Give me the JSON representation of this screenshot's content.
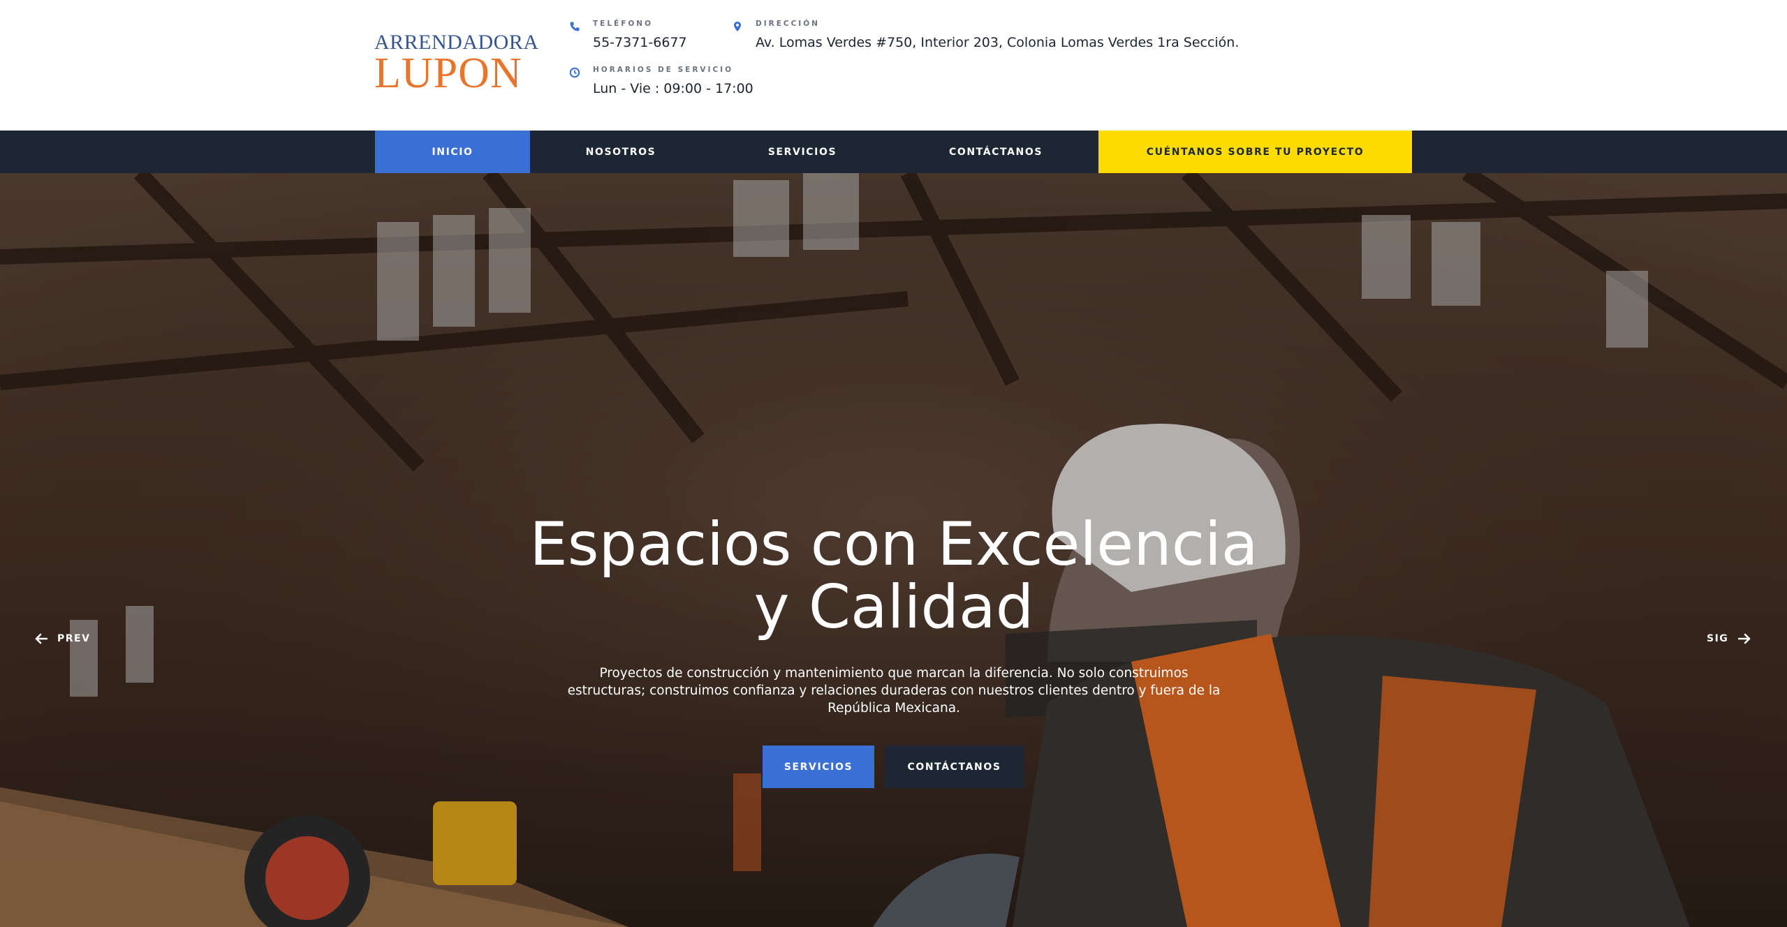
{
  "brand": {
    "logo_top": "ARRENDADORA",
    "logo_bottom": "LUPON",
    "color_blue": "#36558f",
    "color_orange": "#e8752b"
  },
  "contact": {
    "phone_label": "TELÉFONO",
    "phone_value": "55-7371-6677",
    "phone_icon": "phone-icon",
    "address_label": "DIRECCIÓN",
    "address_value": "Av. Lomas Verdes #750, Interior 203, Colonia Lomas Verdes 1ra Sección.",
    "address_icon": "map-pin-icon",
    "hours_label": "HORARIOS DE SERVICIO",
    "hours_value": "Lun - Vie : 09:00 - 17:00",
    "hours_icon": "clock-icon"
  },
  "nav": {
    "items": [
      {
        "label": "INICIO",
        "active": true
      },
      {
        "label": "NOSOTROS"
      },
      {
        "label": "SERVICIOS"
      },
      {
        "label": "CONTÁCTANOS"
      }
    ],
    "cta_label": "CUÉNTANOS SOBRE TU PROYECTO"
  },
  "hero": {
    "title_line1": "Espacios con Excelencia",
    "title_line2": "y Calidad",
    "text": "Proyectos de construcción y mantenimiento que marcan la diferencia. No solo construimos estructuras; construimos confianza y relaciones duraderas con nuestros clientes dentro y fuera de la República Mexicana.",
    "btn_primary": "SERVICIOS",
    "btn_secondary": "CONTÁCTANOS",
    "prev_label": "PREV",
    "next_label": "SIG",
    "image_subject": "construction worker with helmet and power tools in warehouse"
  },
  "colors": {
    "nav_bg": "#1c2733",
    "primary_blue": "#3a6fd4",
    "cta_yellow": "#ffdc00"
  }
}
